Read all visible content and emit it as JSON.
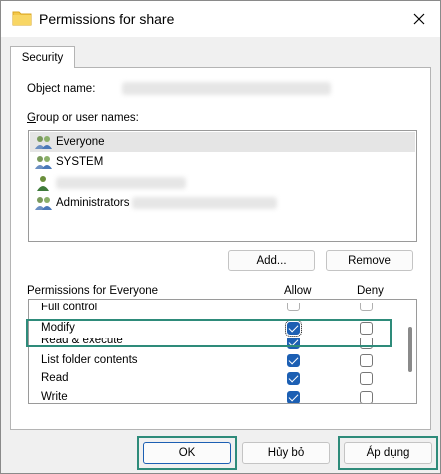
{
  "window": {
    "title": "Permissions for share"
  },
  "tabs": [
    {
      "label": "Security"
    }
  ],
  "object": {
    "label": "Object name:"
  },
  "groups": {
    "label": "Group or user names:",
    "items": [
      {
        "name": "Everyone",
        "icon": "users-group-icon",
        "selected": true
      },
      {
        "name": "SYSTEM",
        "icon": "users-group-icon"
      },
      {
        "name": "",
        "icon": "user-icon"
      },
      {
        "name": "Administrators",
        "icon": "users-group-icon"
      }
    ]
  },
  "buttons": {
    "add": "Add...",
    "remove": "Remove",
    "ok": "OK",
    "cancel": "Hủy bỏ",
    "apply": "Áp dụng"
  },
  "permissions": {
    "label": "Permissions for Everyone",
    "allow_header": "Allow",
    "deny_header": "Deny",
    "rows": [
      {
        "name": "Full control",
        "allow": false,
        "deny": false
      },
      {
        "name": "Modify",
        "allow": true,
        "deny": false
      },
      {
        "name": "Read & execute",
        "allow": true,
        "deny": false
      },
      {
        "name": "List folder contents",
        "allow": true,
        "deny": false
      },
      {
        "name": "Read",
        "allow": true,
        "deny": false
      },
      {
        "name": "Write",
        "allow": true,
        "deny": false
      }
    ]
  },
  "colors": {
    "accent": "#1c5fb3",
    "highlight": "#2e8b7a"
  }
}
